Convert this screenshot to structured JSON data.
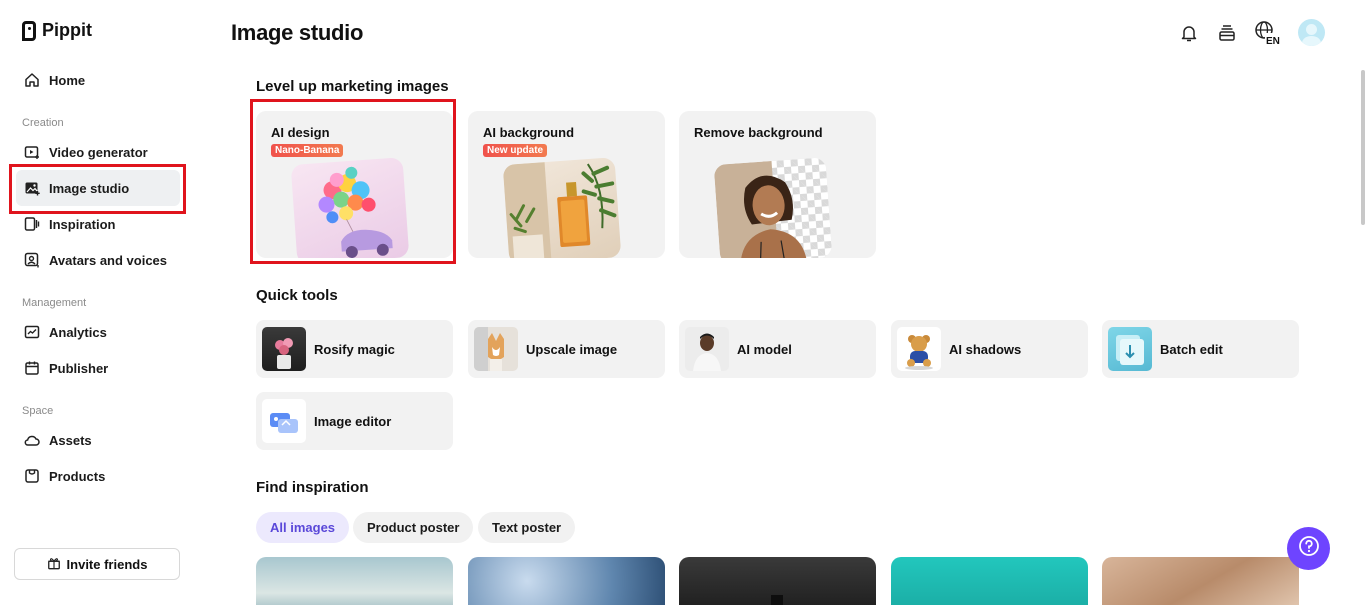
{
  "app": {
    "name": "Pippit"
  },
  "sidebar": {
    "home": "Home",
    "sections": {
      "creation": "Creation",
      "management": "Management",
      "space": "Space"
    },
    "items": [
      {
        "label": "Video generator"
      },
      {
        "label": "Image studio"
      },
      {
        "label": "Inspiration"
      },
      {
        "label": "Avatars and voices"
      },
      {
        "label": "Analytics"
      },
      {
        "label": "Publisher"
      },
      {
        "label": "Assets"
      },
      {
        "label": "Products"
      }
    ],
    "invite": "Invite friends",
    "active_item": "Image studio"
  },
  "header": {
    "title": "Image studio",
    "icons": [
      "bell-icon",
      "stack-icon",
      "globe-language-icon",
      "avatar"
    ],
    "language": "EN"
  },
  "marketing": {
    "title": "Level up marketing images",
    "cards": [
      {
        "title": "AI design",
        "badge": "Nano-Banana"
      },
      {
        "title": "AI background",
        "badge": "New update"
      },
      {
        "title": "Remove background",
        "badge": ""
      }
    ]
  },
  "quick_tools": {
    "title": "Quick tools",
    "items": [
      {
        "label": "Rosify magic"
      },
      {
        "label": "Upscale image"
      },
      {
        "label": "AI model"
      },
      {
        "label": "AI shadows"
      },
      {
        "label": "Batch edit"
      },
      {
        "label": "Image editor"
      }
    ]
  },
  "inspiration": {
    "title": "Find inspiration",
    "filters": [
      "All images",
      "Product poster",
      "Text poster"
    ],
    "active_filter": "All images"
  },
  "colors": {
    "accent": "#6e44ff",
    "highlight": "#e0141d",
    "badge": "#f0524c",
    "chip_active": "#5a48d9"
  }
}
